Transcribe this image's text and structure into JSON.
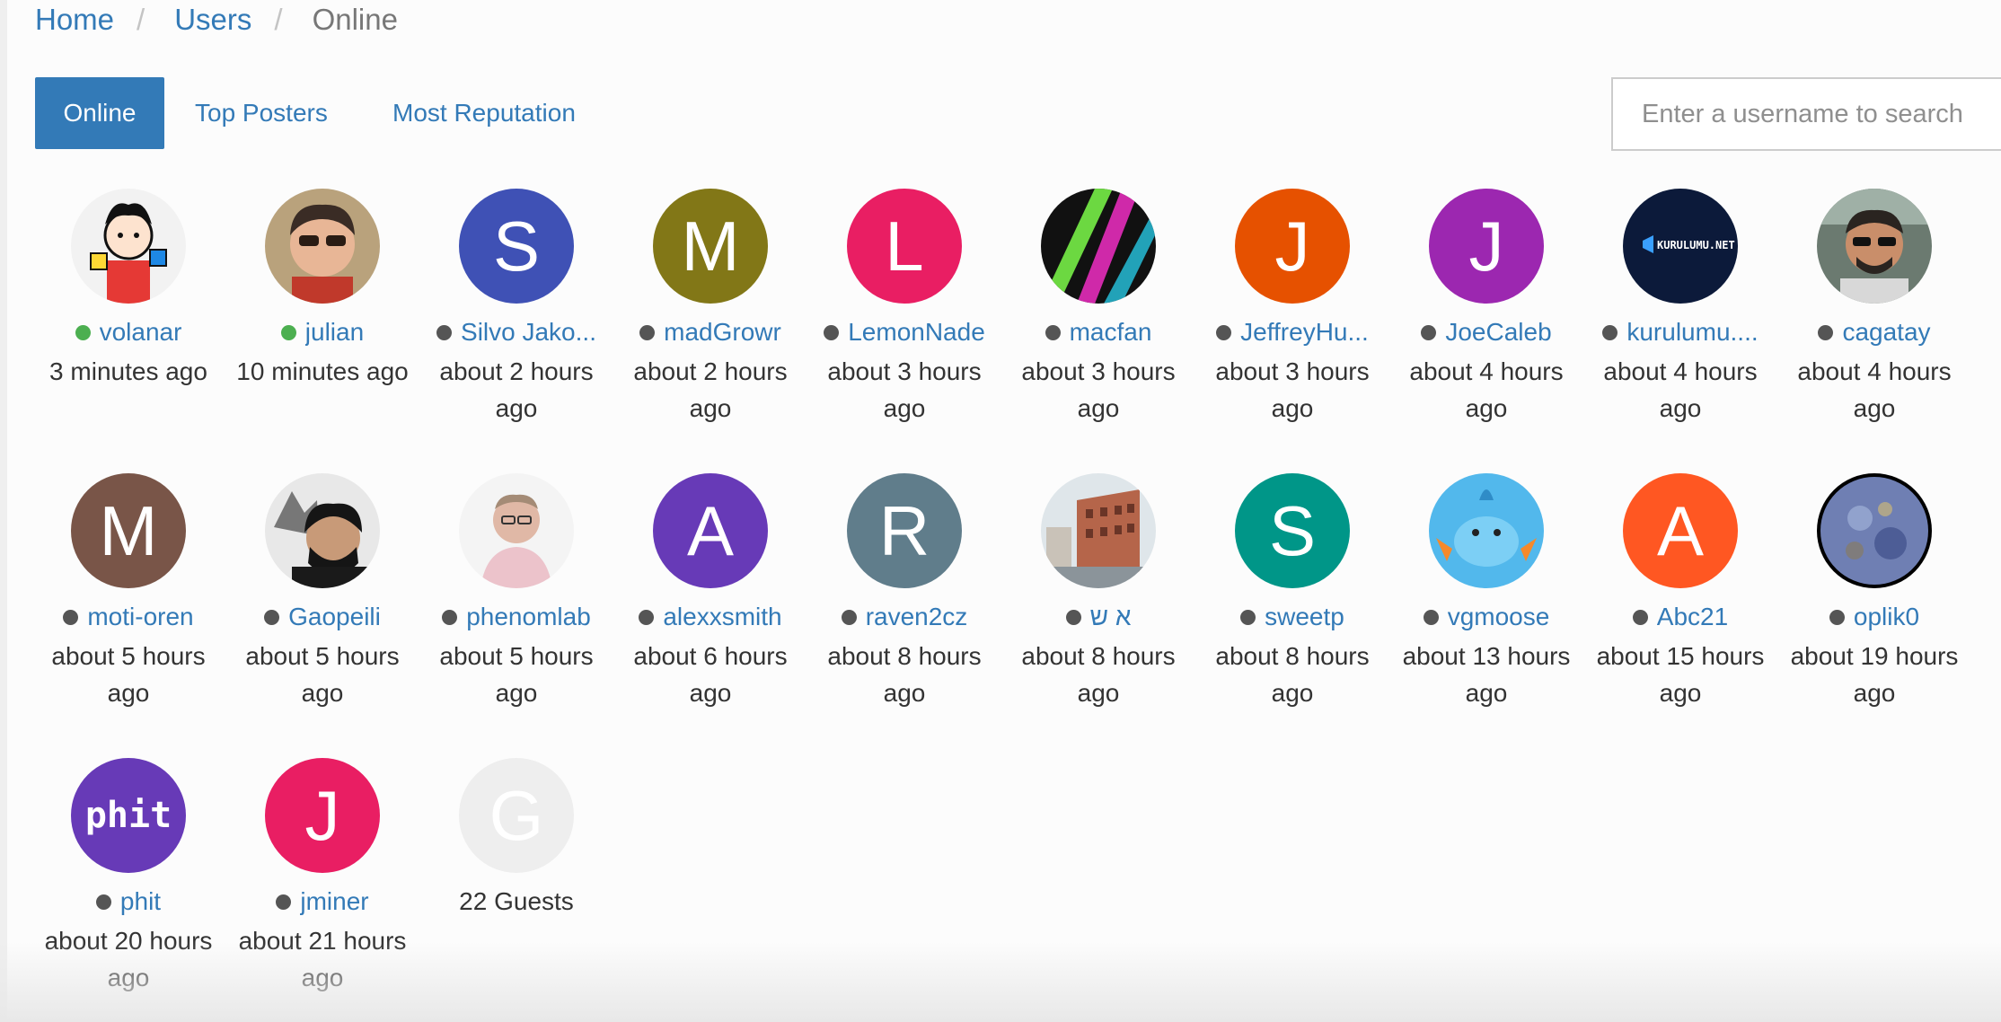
{
  "breadcrumb": {
    "home": "Home",
    "users": "Users",
    "current": "Online",
    "separator": "/"
  },
  "tabs": [
    {
      "label": "Online",
      "active": true
    },
    {
      "label": "Top Posters",
      "active": false
    },
    {
      "label": "Most Reputation",
      "active": false
    }
  ],
  "search": {
    "placeholder": "Enter a username to search"
  },
  "colors": {
    "accent": "#337ab7",
    "online": "#4caf50",
    "offline": "#555555"
  },
  "users": [
    {
      "name": "volanar",
      "time": "3 minutes ago",
      "status": "online",
      "avatar": "image",
      "icon": "cartoon-boy-avatar"
    },
    {
      "name": "julian",
      "time": "10 minutes ago",
      "status": "online",
      "avatar": "image",
      "icon": "man-sunglasses-avatar"
    },
    {
      "name": "Silvo Jako...",
      "time": "about 2 hours ago",
      "status": "away",
      "avatar": "letter",
      "letter": "S",
      "color": "#3f51b5"
    },
    {
      "name": "madGrowr",
      "time": "about 2 hours ago",
      "status": "away",
      "avatar": "letter",
      "letter": "M",
      "color": "#827717"
    },
    {
      "name": "LemonNade",
      "time": "about 3 hours ago",
      "status": "away",
      "avatar": "letter",
      "letter": "L",
      "color": "#e91e63"
    },
    {
      "name": "macfan",
      "time": "about 3 hours ago",
      "status": "away",
      "avatar": "image",
      "icon": "neon-light-avatar"
    },
    {
      "name": "JeffreyHu...",
      "time": "about 3 hours ago",
      "status": "away",
      "avatar": "letter",
      "letter": "J",
      "color": "#e65100"
    },
    {
      "name": "JoeCaleb",
      "time": "about 4 hours ago",
      "status": "away",
      "avatar": "letter",
      "letter": "J",
      "color": "#9c27b0"
    },
    {
      "name": "kurulumu....",
      "time": "about 4 hours ago",
      "status": "away",
      "avatar": "image",
      "icon": "kurulumu-logo-avatar",
      "logo_text": "KURULUMU.NET"
    },
    {
      "name": "cagatay",
      "time": "about 4 hours ago",
      "status": "away",
      "avatar": "image",
      "icon": "man-car-selfie-avatar"
    },
    {
      "name": "moti-oren",
      "time": "about 5 hours ago",
      "status": "away",
      "avatar": "letter",
      "letter": "M",
      "color": "#795548"
    },
    {
      "name": "Gaopeili",
      "time": "about 5 hours ago",
      "status": "away",
      "avatar": "image",
      "icon": "wolf-drawing-avatar"
    },
    {
      "name": "phenomlab",
      "time": "about 5 hours ago",
      "status": "away",
      "avatar": "image",
      "icon": "man-portrait-avatar"
    },
    {
      "name": "alexxsmith",
      "time": "about 6 hours ago",
      "status": "away",
      "avatar": "letter",
      "letter": "A",
      "color": "#673ab7"
    },
    {
      "name": "raven2cz",
      "time": "about 8 hours ago",
      "status": "away",
      "avatar": "letter",
      "letter": "R",
      "color": "#607d8b"
    },
    {
      "name": "א ש",
      "time": "about 8 hours ago",
      "status": "away",
      "avatar": "image",
      "icon": "building-photo-avatar"
    },
    {
      "name": "sweetp",
      "time": "about 8 hours ago",
      "status": "away",
      "avatar": "letter",
      "letter": "S",
      "color": "#009688"
    },
    {
      "name": "vgmoose",
      "time": "about 13 hours ago",
      "status": "away",
      "avatar": "image",
      "icon": "mudkip-avatar"
    },
    {
      "name": "Abc21",
      "time": "about 15 hours ago",
      "status": "away",
      "avatar": "letter",
      "letter": "A",
      "color": "#ff5722"
    },
    {
      "name": "oplik0",
      "time": "about 19 hours ago",
      "status": "away",
      "avatar": "image",
      "icon": "planet-avatar"
    },
    {
      "name": "phit",
      "time": "about 20 hours ago",
      "status": "away",
      "avatar": "image",
      "icon": "phit-pixel-logo-avatar",
      "logo_text": "phit"
    },
    {
      "name": "jminer",
      "time": "about 21 hours ago",
      "status": "away",
      "avatar": "letter",
      "letter": "J",
      "color": "#e91e63"
    }
  ],
  "guests": {
    "letter": "G",
    "label": "22 Guests",
    "color": "#eeeeee"
  }
}
